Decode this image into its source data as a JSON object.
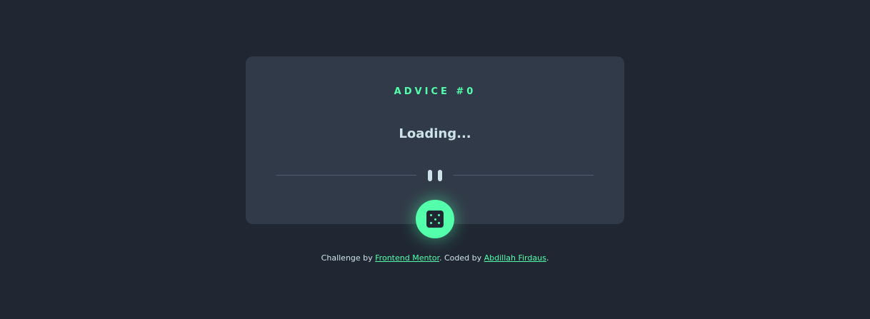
{
  "card": {
    "title": "ADVICE #0",
    "advice_text": "Loading..."
  },
  "icons": {
    "divider": "pause-icon",
    "button": "dice-icon"
  },
  "colors": {
    "background": "#202733",
    "card": "#313a48",
    "accent": "#53ffaa",
    "text": "#cee3e9",
    "divider": "#4f5d74"
  },
  "attribution": {
    "prefix": "Challenge by ",
    "link1": "Frontend Mentor",
    "middle": ". Coded by ",
    "link2": "Abdillah Firdaus",
    "suffix": "."
  }
}
